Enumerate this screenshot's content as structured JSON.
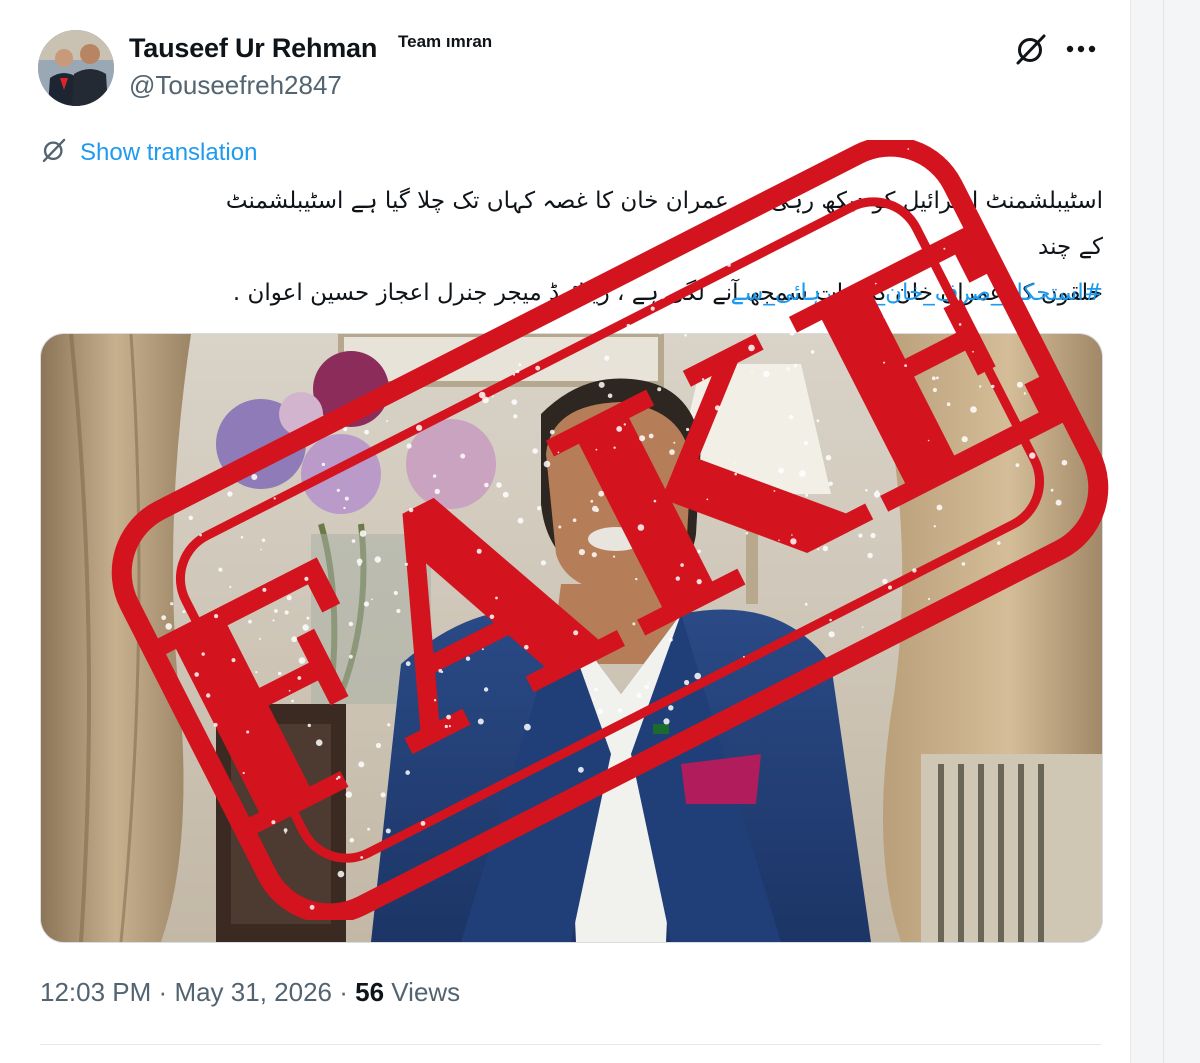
{
  "tweet": {
    "author": {
      "display_name": "Tauseef Ur Rehman",
      "badge_text": "Team ımran",
      "handle": "@Touseefreh2847"
    },
    "header_icons": [
      "grok-icon",
      "more-icon"
    ],
    "show_translation_label": "Show translation",
    "body_lines": [
      "اسٹیبلشمنٹ اسرائیل کو دیکھ رہی ہے عمران خان کا غصہ کہاں تک چلا گیا ہے اسٹیبلشمنٹ کے چند",
      "حلقوں کو عمران خان کی بات سمجھ آنے لگی ہے ، ریٹائرڈ میجر جنرل اعجاز حسین اعوان ."
    ],
    "hashtag": "#استحکام_صرف_خان_کی_رہائی_سے",
    "time": "12:03 PM",
    "separator": "·",
    "date": "May 31, 2026",
    "views_count": "56",
    "views_label": "Views"
  },
  "overlay": {
    "stamp_text": "FAKE",
    "stamp_color": "#d3141f"
  },
  "colors": {
    "link": "#1d9bf0",
    "secondary_text": "#536471",
    "primary_text": "#0f1419"
  }
}
